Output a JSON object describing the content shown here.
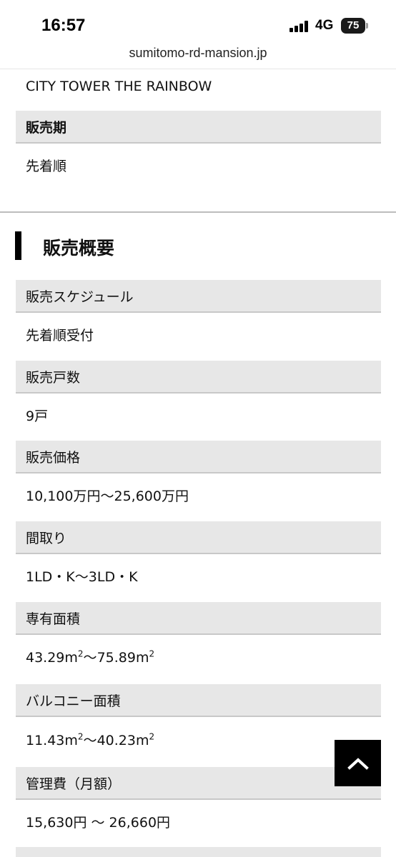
{
  "status_bar": {
    "time": "16:57",
    "network": "4G",
    "battery": "75",
    "signal_icon": "signal-bars-icon"
  },
  "browser": {
    "url": "sumitomo-rd-mansion.jp"
  },
  "top": {
    "property_name": "CITY TOWER THE RAINBOW",
    "sales_period_label": "販売期",
    "sales_period_value": "先着順"
  },
  "section": {
    "title": "販売概要"
  },
  "rows": [
    {
      "label": "販売スケジュール",
      "value": "先着順受付"
    },
    {
      "label": "販売戸数",
      "value": "9戸"
    },
    {
      "label": "販売価格",
      "value": "10,100万円〜25,600万円"
    },
    {
      "label": "間取り",
      "value": "1LD・K〜3LD・K"
    },
    {
      "label": "専有面積",
      "value": {
        "from": "43.29m",
        "to": "75.89m",
        "sup": "2",
        "sep": "〜"
      }
    },
    {
      "label": "バルコニー面積",
      "value": {
        "from": "11.43m",
        "to": "40.23m",
        "sup": "2",
        "sep": "〜"
      }
    },
    {
      "label": "管理費（月額）",
      "value": "15,630円 〜 26,660円"
    },
    {
      "label": "",
      "value": ""
    }
  ],
  "scroll_top": {
    "icon": "chevron-up-icon",
    "color": "#000000"
  }
}
